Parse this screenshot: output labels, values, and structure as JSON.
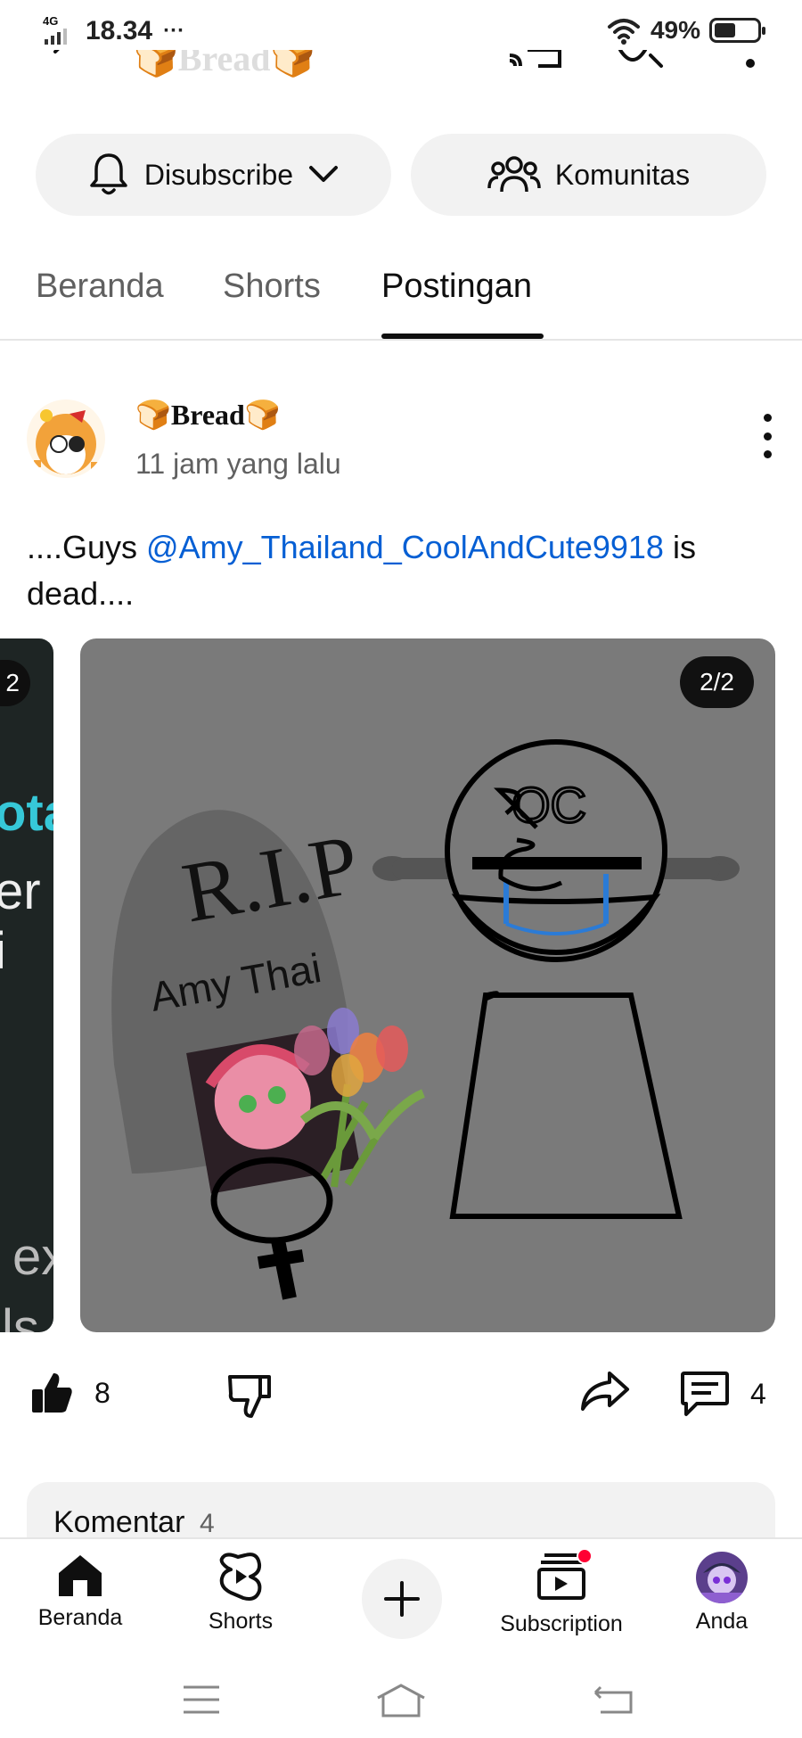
{
  "status_bar": {
    "network": "4G",
    "time": "18.34",
    "more": "···",
    "battery_percent": "49%",
    "battery_level": 0.49
  },
  "header": {
    "channel_name": "🍞Bread🍞"
  },
  "actions": {
    "subscribe_label": "Disubscribe",
    "community_label": "Komunitas"
  },
  "tabs": [
    {
      "label": "Beranda",
      "active": false
    },
    {
      "label": "Shorts",
      "active": false
    },
    {
      "label": "Postingan",
      "active": true
    }
  ],
  "post": {
    "author": "🍞Bread🍞",
    "time_ago": "11 jam yang lalu",
    "text_before": "....Guys ",
    "mention": "@Amy_Thailand_CoolAndCute9918",
    "text_after": " is dead....",
    "prev_counter": "2",
    "image_counter": "2/2",
    "image_text": {
      "rip": "R.I.P",
      "name": "Amy Thai",
      "oc": "OC"
    },
    "prev_card_text": [
      "ota",
      "er i",
      "ex",
      "ls"
    ]
  },
  "engagement": {
    "likes": "8",
    "comments": "4"
  },
  "comments_section": {
    "label": "Komentar",
    "count": "4"
  },
  "bottom_nav": {
    "home": "Beranda",
    "shorts": "Shorts",
    "subscriptions": "Subscription",
    "you": "Anda"
  },
  "colors": {
    "mention": "#065fd4",
    "notification_dot": "#ff0033",
    "image_background": "#7a7a7a"
  }
}
